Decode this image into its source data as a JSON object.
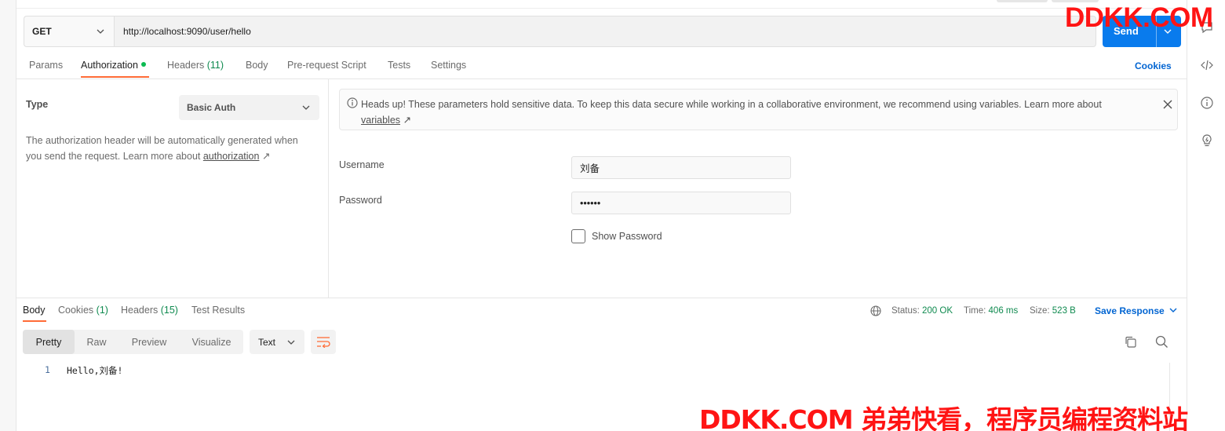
{
  "request": {
    "method": "GET",
    "url": "http://localhost:9090/user/hello",
    "send_label": "Send"
  },
  "request_tabs": [
    {
      "label": "Params"
    },
    {
      "label": "Authorization",
      "active": true,
      "has_dot": true
    },
    {
      "label": "Headers",
      "count": "(11)"
    },
    {
      "label": "Body"
    },
    {
      "label": "Pre-request Script"
    },
    {
      "label": "Tests"
    },
    {
      "label": "Settings"
    }
  ],
  "cookies_link": "Cookies",
  "auth": {
    "type_label": "Type",
    "type_value": "Basic Auth",
    "description_prefix": "The authorization header will be automatically generated when you send the request. Learn more about",
    "description_link": "authorization",
    "link_arrow": "↗",
    "banner_text": "Heads up! These parameters hold sensitive data. To keep this data secure while working in a collaborative environment, we recommend using variables. Learn more about",
    "banner_link": "variables",
    "username_label": "Username",
    "username_value": "刘备",
    "password_label": "Password",
    "password_value": "••••••",
    "show_password_label": "Show Password",
    "show_password_checked": false
  },
  "response_tabs": [
    {
      "label": "Body",
      "active": true
    },
    {
      "label": "Cookies",
      "count": "(1)"
    },
    {
      "label": "Headers",
      "count": "(15)"
    },
    {
      "label": "Test Results"
    }
  ],
  "response_status": {
    "status_label": "Status:",
    "status_value": "200 OK",
    "time_label": "Time:",
    "time_value": "406 ms",
    "size_label": "Size:",
    "size_value": "523 B",
    "save_response": "Save Response"
  },
  "view_options": [
    "Pretty",
    "Raw",
    "Preview",
    "Visualize"
  ],
  "selected_view": "Pretty",
  "format": "Text",
  "code": {
    "line_number": "1",
    "line_text": "Hello,刘备!"
  },
  "watermark": {
    "top": "DDKK.COM",
    "bottom": "DDKK.COM 弟弟快看，程序员编程资料站"
  },
  "colors": {
    "accent_orange": "#ff6c37",
    "send_blue": "#097bed",
    "link_blue": "#0265d2",
    "success_green": "#0f8a4f",
    "dot_green": "#0cbb52",
    "watermark_red": "#ff1414"
  },
  "icons": {
    "right_sidebar": [
      "comments-icon",
      "code-icon",
      "info-icon",
      "lightbulb-icon"
    ]
  }
}
